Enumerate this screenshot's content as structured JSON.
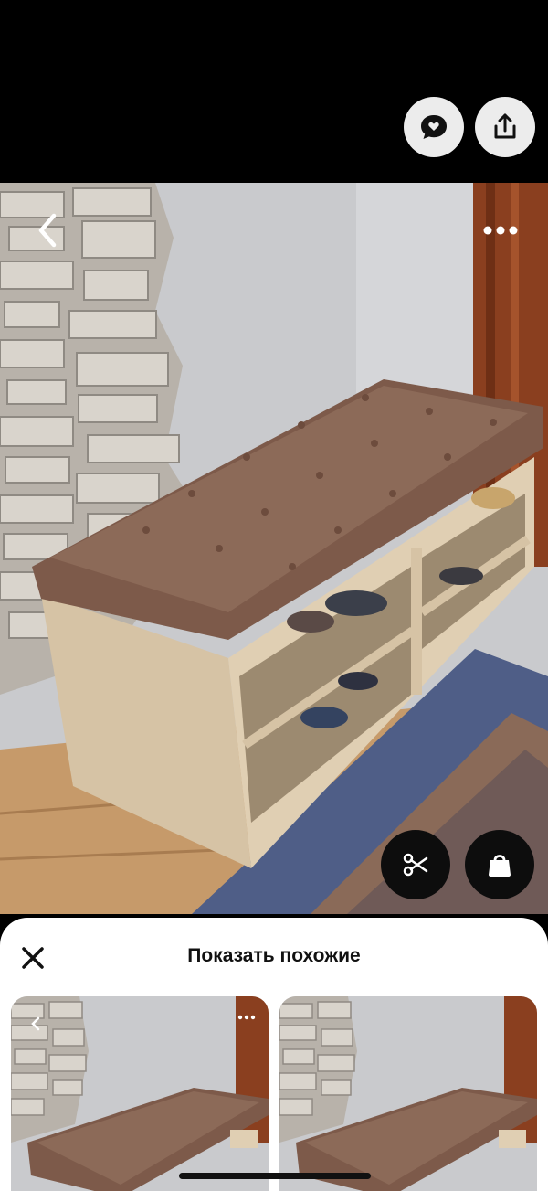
{
  "topbar": {
    "comment_icon": "speech-bubble-heart-icon",
    "share_icon": "share-upload-icon"
  },
  "photo": {
    "subject": "",
    "back_icon": "chevron-left-icon",
    "more_icon": "ellipsis-icon",
    "scissors_icon": "scissors-icon",
    "bag_icon": "shopping-bag-icon"
  },
  "sheet": {
    "close_icon": "close-icon",
    "title": "Показать похожие",
    "results_count_visible": 2
  },
  "colors": {
    "cushion": "#8c6a58",
    "wood": "#d6c3a5",
    "wall": "#c9cacd",
    "rug_blue": "#4f5e87",
    "rug_brown": "#8a6a58"
  }
}
